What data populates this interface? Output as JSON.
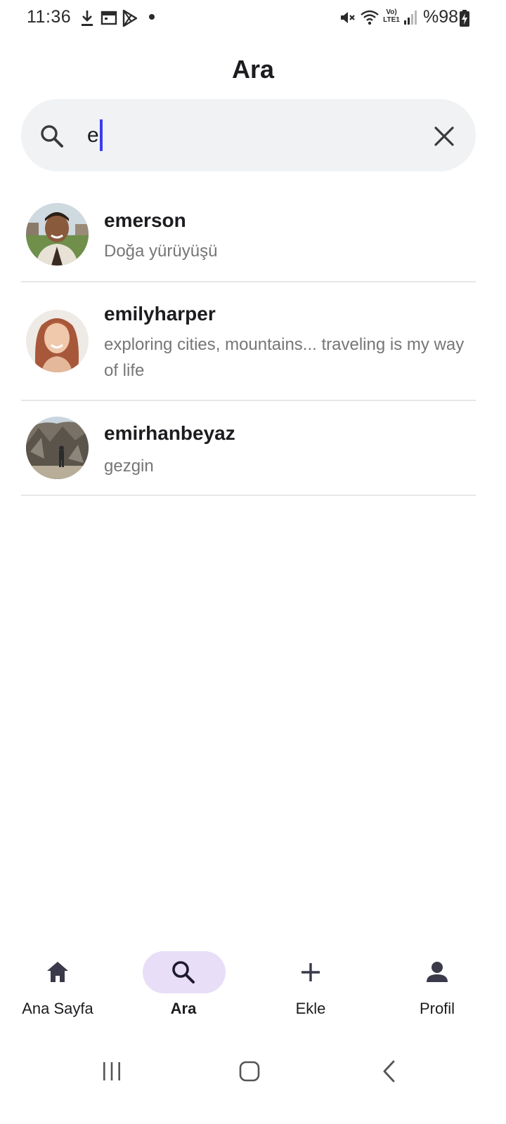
{
  "status_bar": {
    "time": "11:36",
    "battery": "%98",
    "left_icons": [
      "download-icon",
      "calendar-icon",
      "play-store-icon",
      "dot-icon"
    ],
    "right_icons": [
      "mute-icon",
      "wifi-icon",
      "volte-icon",
      "signal-icon",
      "battery-charging-icon"
    ],
    "volte_label": "Vo) LTE1"
  },
  "header": {
    "title": "Ara"
  },
  "search": {
    "value": "e",
    "placeholder": "",
    "caret_color": "#3b3bf2"
  },
  "results": [
    {
      "username": "emerson",
      "bio": "Doğa yürüyüşü"
    },
    {
      "username": "emilyharper",
      "bio": "exploring cities, mountains... traveling is my way of life"
    },
    {
      "username": "emirhanbeyaz",
      "bio": "gezgin"
    }
  ],
  "bottom_nav": {
    "items": [
      {
        "label": "Ana Sayfa",
        "icon": "home-icon",
        "active": false
      },
      {
        "label": "Ara",
        "icon": "search-icon",
        "active": true
      },
      {
        "label": "Ekle",
        "icon": "plus-icon",
        "active": false
      },
      {
        "label": "Profil",
        "icon": "person-icon",
        "active": false
      }
    ],
    "active_color": "#e8def8"
  },
  "system_nav": [
    "recents-icon",
    "home-button-icon",
    "back-icon"
  ]
}
